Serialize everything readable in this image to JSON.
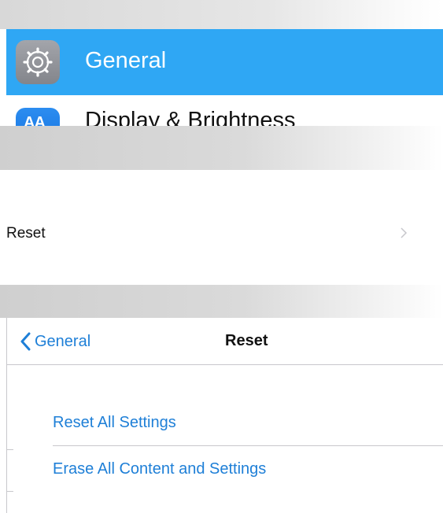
{
  "settings_list": {
    "items": [
      {
        "label": "General",
        "icon": "gear-icon",
        "icon_color": "#8e9096",
        "selected": true
      },
      {
        "label": "Display & Brightness",
        "icon": "display-brightness-icon",
        "icon_glyph": "AA",
        "icon_color": "#1a7ae6",
        "selected": false
      }
    ],
    "selected_color": "#2fa7f4"
  },
  "general_screen": {
    "reset_row": {
      "label": "Reset",
      "accessory": "chevron-right-icon"
    }
  },
  "reset_screen": {
    "nav": {
      "back_label": "General",
      "back_icon": "chevron-left-icon",
      "title": "Reset"
    },
    "actions": [
      {
        "label": "Reset All Settings"
      },
      {
        "label": "Erase All Content and Settings"
      }
    ],
    "tint_color": "#1e7fd7"
  }
}
